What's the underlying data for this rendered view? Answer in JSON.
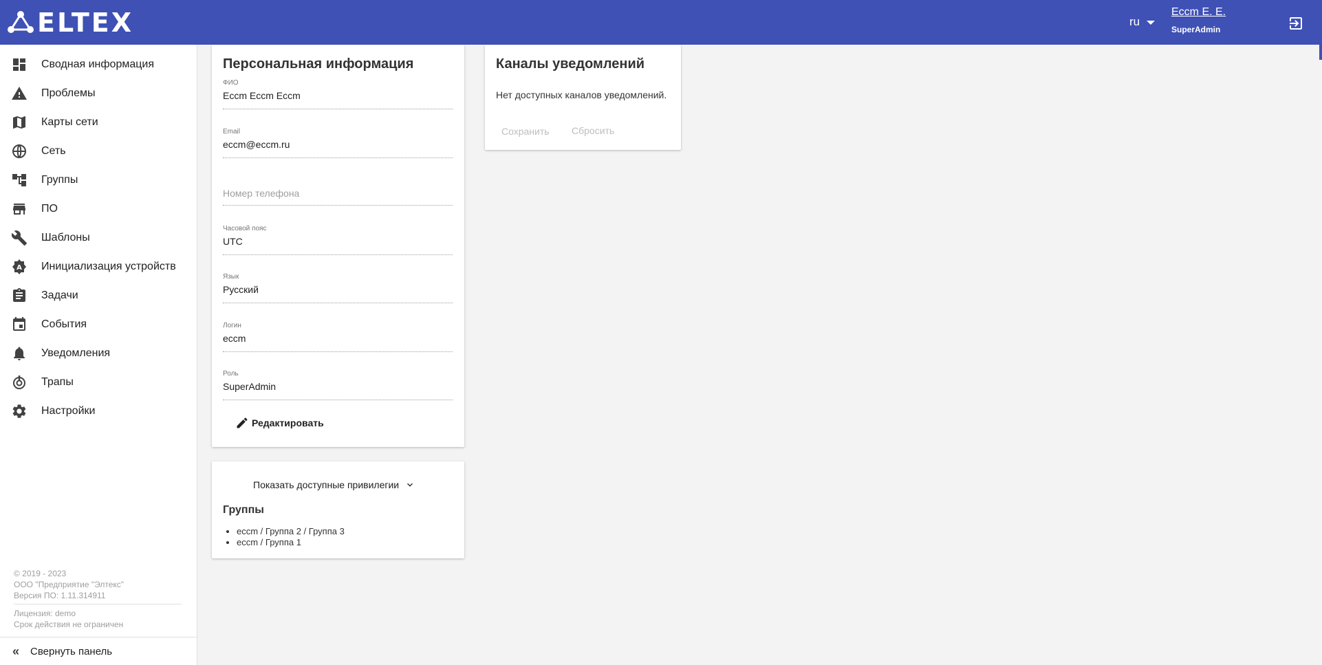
{
  "header": {
    "logo_text": "ELTEX",
    "lang": "ru",
    "user_name": "Eccm E. E.",
    "user_role": "SuperAdmin",
    "bg_color": "#3f51b5"
  },
  "sidebar": {
    "items": [
      {
        "label": "Сводная информация",
        "icon": "dashboard-icon"
      },
      {
        "label": "Проблемы",
        "icon": "warning-icon"
      },
      {
        "label": "Карты сети",
        "icon": "map-icon"
      },
      {
        "label": "Сеть",
        "icon": "globe-icon"
      },
      {
        "label": "Группы",
        "icon": "tree-icon"
      },
      {
        "label": "ПО",
        "icon": "store-icon"
      },
      {
        "label": "Шаблоны",
        "icon": "wrench-icon"
      },
      {
        "label": "Инициализация устройств",
        "icon": "badge-icon"
      },
      {
        "label": "Задачи",
        "icon": "clipboard-icon"
      },
      {
        "label": "События",
        "icon": "calendar-icon"
      },
      {
        "label": "Уведомления",
        "icon": "bell-icon"
      },
      {
        "label": "Трапы",
        "icon": "trap-icon"
      },
      {
        "label": "Настройки",
        "icon": "gear-icon"
      }
    ],
    "footer": {
      "copyright": "© 2019 - 2023",
      "company": "ООО \"Предприятие \"Элтекс\"",
      "version": "Версия ПО: 1.11.314911",
      "license": "Лицензия: demo",
      "expiry": "Срок действия не ограничен"
    },
    "collapse_label": "Свернуть панель"
  },
  "personal": {
    "title": "Персональная информация",
    "fields": [
      {
        "label": "ФИО",
        "value": "Eccm Eccm Eccm"
      },
      {
        "label": "Email",
        "value": "eccm@eccm.ru"
      },
      {
        "label": "",
        "placeholder": "Номер телефона"
      },
      {
        "label": "Часовой пояс",
        "value": "UTC"
      },
      {
        "label": "Язык",
        "value": "Русский"
      },
      {
        "label": "Логин",
        "value": "eccm"
      },
      {
        "label": "Роль",
        "value": "SuperAdmin"
      }
    ],
    "edit_label": "Редактировать"
  },
  "privileges": {
    "toggle_label": "Показать доступные привилегии",
    "groups_title": "Группы",
    "groups": [
      "eccm / Группа 2 / Группа 3",
      "eccm / Группа 1"
    ]
  },
  "notifications": {
    "title": "Каналы уведомлений",
    "empty_text": "Нет доступных каналов уведомлений.",
    "save_label": "Сохранить",
    "reset_label": "Сбросить"
  }
}
